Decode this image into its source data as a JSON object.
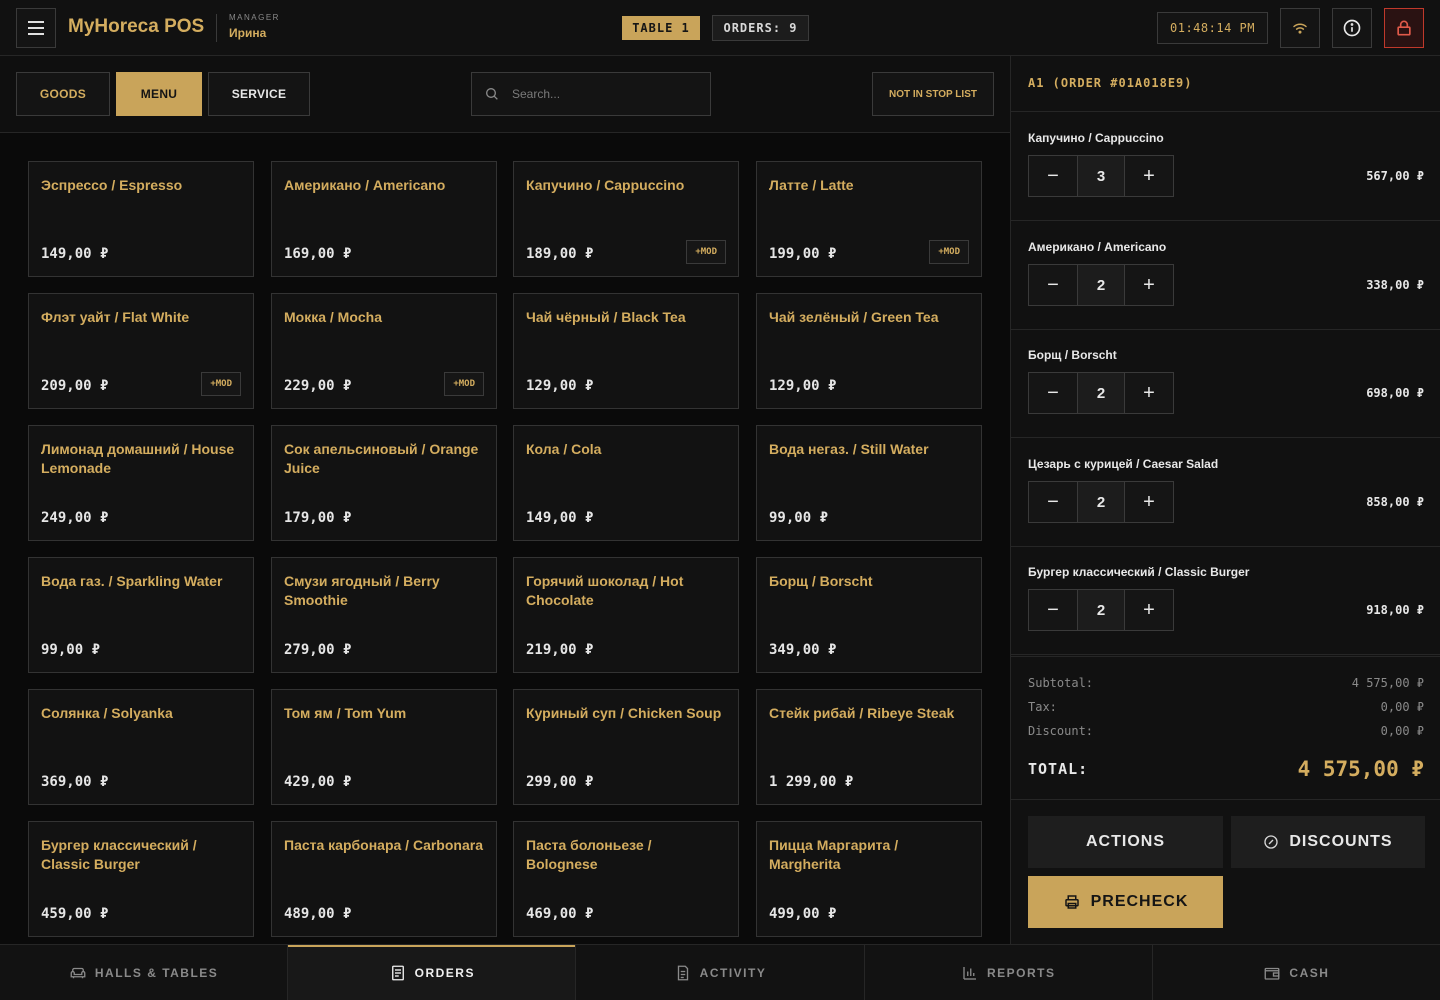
{
  "header": {
    "brand": "MyHoreca POS",
    "role_label": "MANAGER",
    "user_name": "Ирина",
    "table_badge": "TABLE 1",
    "orders_badge": "ORDERS: 9",
    "clock": "01:48:14 PM",
    "icons": {
      "menu": "hamburger-icon",
      "wifi": "wifi-icon",
      "info": "info-icon",
      "lock": "lock-icon"
    }
  },
  "toolbar": {
    "tabs": [
      "GOODS",
      "MENU",
      "SERVICE"
    ],
    "active_tab": "MENU",
    "search_placeholder": "Search...",
    "stoplist_label": "NOT IN STOP LIST"
  },
  "products": [
    {
      "name": "Эспрессо / Espresso",
      "price": "149,00 ₽",
      "mod": ""
    },
    {
      "name": "Американо / Americano",
      "price": "169,00 ₽",
      "mod": ""
    },
    {
      "name": "Капучино / Cappuccino",
      "price": "189,00 ₽",
      "mod": "+MOD"
    },
    {
      "name": "Латте / Latte",
      "price": "199,00 ₽",
      "mod": "+MOD"
    },
    {
      "name": "Флэт уайт / Flat White",
      "price": "209,00 ₽",
      "mod": "+MOD"
    },
    {
      "name": "Мокка / Mocha",
      "price": "229,00 ₽",
      "mod": "+MOD"
    },
    {
      "name": "Чай чёрный / Black Tea",
      "price": "129,00 ₽",
      "mod": ""
    },
    {
      "name": "Чай зелёный / Green Tea",
      "price": "129,00 ₽",
      "mod": ""
    },
    {
      "name": "Лимонад домашний / House Lemonade",
      "price": "249,00 ₽",
      "mod": ""
    },
    {
      "name": "Сок апельсиновый / Orange Juice",
      "price": "179,00 ₽",
      "mod": ""
    },
    {
      "name": "Кола / Cola",
      "price": "149,00 ₽",
      "mod": ""
    },
    {
      "name": "Вода негаз. / Still Water",
      "price": "99,00 ₽",
      "mod": ""
    },
    {
      "name": "Вода газ. / Sparkling Water",
      "price": "99,00 ₽",
      "mod": ""
    },
    {
      "name": "Смузи ягодный / Berry Smoothie",
      "price": "279,00 ₽",
      "mod": ""
    },
    {
      "name": "Горячий шоколад / Hot Chocolate",
      "price": "219,00 ₽",
      "mod": ""
    },
    {
      "name": "Борщ / Borscht",
      "price": "349,00 ₽",
      "mod": ""
    },
    {
      "name": "Солянка / Solyanka",
      "price": "369,00 ₽",
      "mod": ""
    },
    {
      "name": "Том ям / Tom Yum",
      "price": "429,00 ₽",
      "mod": ""
    },
    {
      "name": "Куриный суп / Chicken Soup",
      "price": "299,00 ₽",
      "mod": ""
    },
    {
      "name": "Стейк рибай / Ribeye Steak",
      "price": "1 299,00 ₽",
      "mod": ""
    },
    {
      "name": "Бургер классический / Classic Burger",
      "price": "459,00 ₽",
      "mod": ""
    },
    {
      "name": "Паста карбонара / Carbonara",
      "price": "489,00 ₽",
      "mod": ""
    },
    {
      "name": "Паста болоньезе / Bolognese",
      "price": "469,00 ₽",
      "mod": ""
    },
    {
      "name": "Пицца Маргарита / Margherita",
      "price": "499,00 ₽",
      "mod": ""
    }
  ],
  "order": {
    "title": "A1 (ORDER #01A018E9)",
    "items": [
      {
        "name": "Капучино / Cappuccino",
        "qty": "3",
        "total": "567,00 ₽"
      },
      {
        "name": "Американо / Americano",
        "qty": "2",
        "total": "338,00 ₽"
      },
      {
        "name": "Борщ / Borscht",
        "qty": "2",
        "total": "698,00 ₽"
      },
      {
        "name": "Цезарь с курицей / Caesar Salad",
        "qty": "2",
        "total": "858,00 ₽"
      },
      {
        "name": "Бургер классический / Classic Burger",
        "qty": "2",
        "total": "918,00 ₽"
      }
    ],
    "minus_label": "−",
    "plus_label": "+",
    "subtotal_label": "Subtotal:",
    "subtotal": "4 575,00 ₽",
    "tax_label": "Tax:",
    "tax": "0,00 ₽",
    "discount_label": "Discount:",
    "discount": "0,00 ₽",
    "total_label": "TOTAL:",
    "total": "4 575,00 ₽"
  },
  "actions": {
    "actions_label": "ACTIONS",
    "discounts_label": "DISCOUNTS",
    "precheck_label": "PRECHECK"
  },
  "bottom_nav": {
    "items": [
      {
        "label": "HALLS & TABLES",
        "icon": "sofa-icon"
      },
      {
        "label": "ORDERS",
        "icon": "receipt-icon"
      },
      {
        "label": "ACTIVITY",
        "icon": "document-icon"
      },
      {
        "label": "REPORTS",
        "icon": "bar-chart-icon"
      },
      {
        "label": "CASH",
        "icon": "wallet-icon"
      }
    ],
    "active": "ORDERS"
  },
  "colors": {
    "accent": "#c9a45a",
    "background": "#0d0d0d",
    "danger": "#c0392b"
  }
}
